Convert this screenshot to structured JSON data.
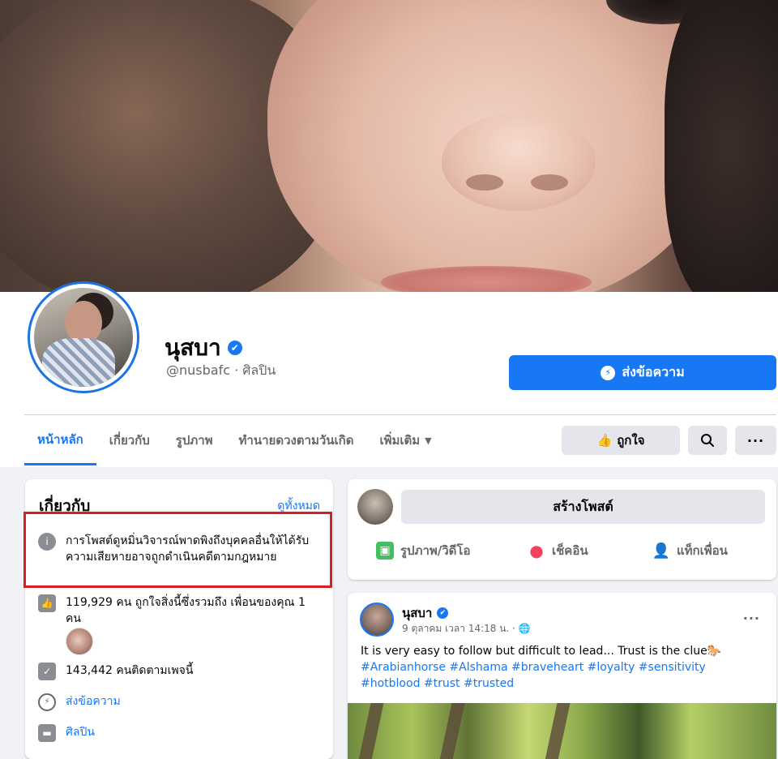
{
  "page": {
    "name": "นุสบา",
    "handle": "@nusbafc · ศิลปิน",
    "message_button": "ส่งข้อความ",
    "verified_glyph": "✔"
  },
  "tabs": [
    {
      "label": "หน้าหลัก",
      "active": true
    },
    {
      "label": "เกี่ยวกับ"
    },
    {
      "label": "รูปภาพ"
    },
    {
      "label": "ทำนายดวงตามวันเกิด"
    },
    {
      "label": "เพิ่มเติม"
    }
  ],
  "actions": {
    "like_label": "ถูกใจ"
  },
  "about": {
    "title": "เกี่ยวกับ",
    "see_all": "ดูทั้งหมด",
    "notice": "การโพสต์ดูหมิ่นวิจารณ์พาดพิงถึงบุคคลอื่นให้ได้รับความเสียหายอาจถูกดำเนินคดีตามกฎหมาย",
    "likes_text": "119,929 คน ถูกใจสิ่งนี้ซึ่งรวมถึง เพื่อนของคุณ 1 คน",
    "followers_text": "143,442 คนติดตามเพจนี้",
    "message_link": "ส่งข้อความ",
    "category": "ศิลปิน"
  },
  "composer": {
    "placeholder": "สร้างโพสต์",
    "photo_video": "รูปภาพ/วิดีโอ",
    "check_in": "เช็คอิน",
    "tag_friends": "แท็กเพื่อน"
  },
  "post": {
    "author": "นุสบา",
    "meta": "9 ตุลาคม เวลา 14:18 น. · 🌐",
    "text": "It is very easy to follow but difficult to lead... Trust is the clue🐎",
    "hashtags": "#Arabianhorse #Alshama #braveheart #loyalty #sensitivity #hotblood #trust #trusted"
  },
  "icons": {
    "info": "info-icon",
    "like": "thumbs-up-icon",
    "followers": "check-badge-icon",
    "messenger": "messenger-icon",
    "category": "folder-icon"
  },
  "colors": {
    "accent": "#1877f2",
    "highlight_border": "#d81d24",
    "photo_icon": "#45bd62",
    "checkin_icon": "#f3425f"
  }
}
